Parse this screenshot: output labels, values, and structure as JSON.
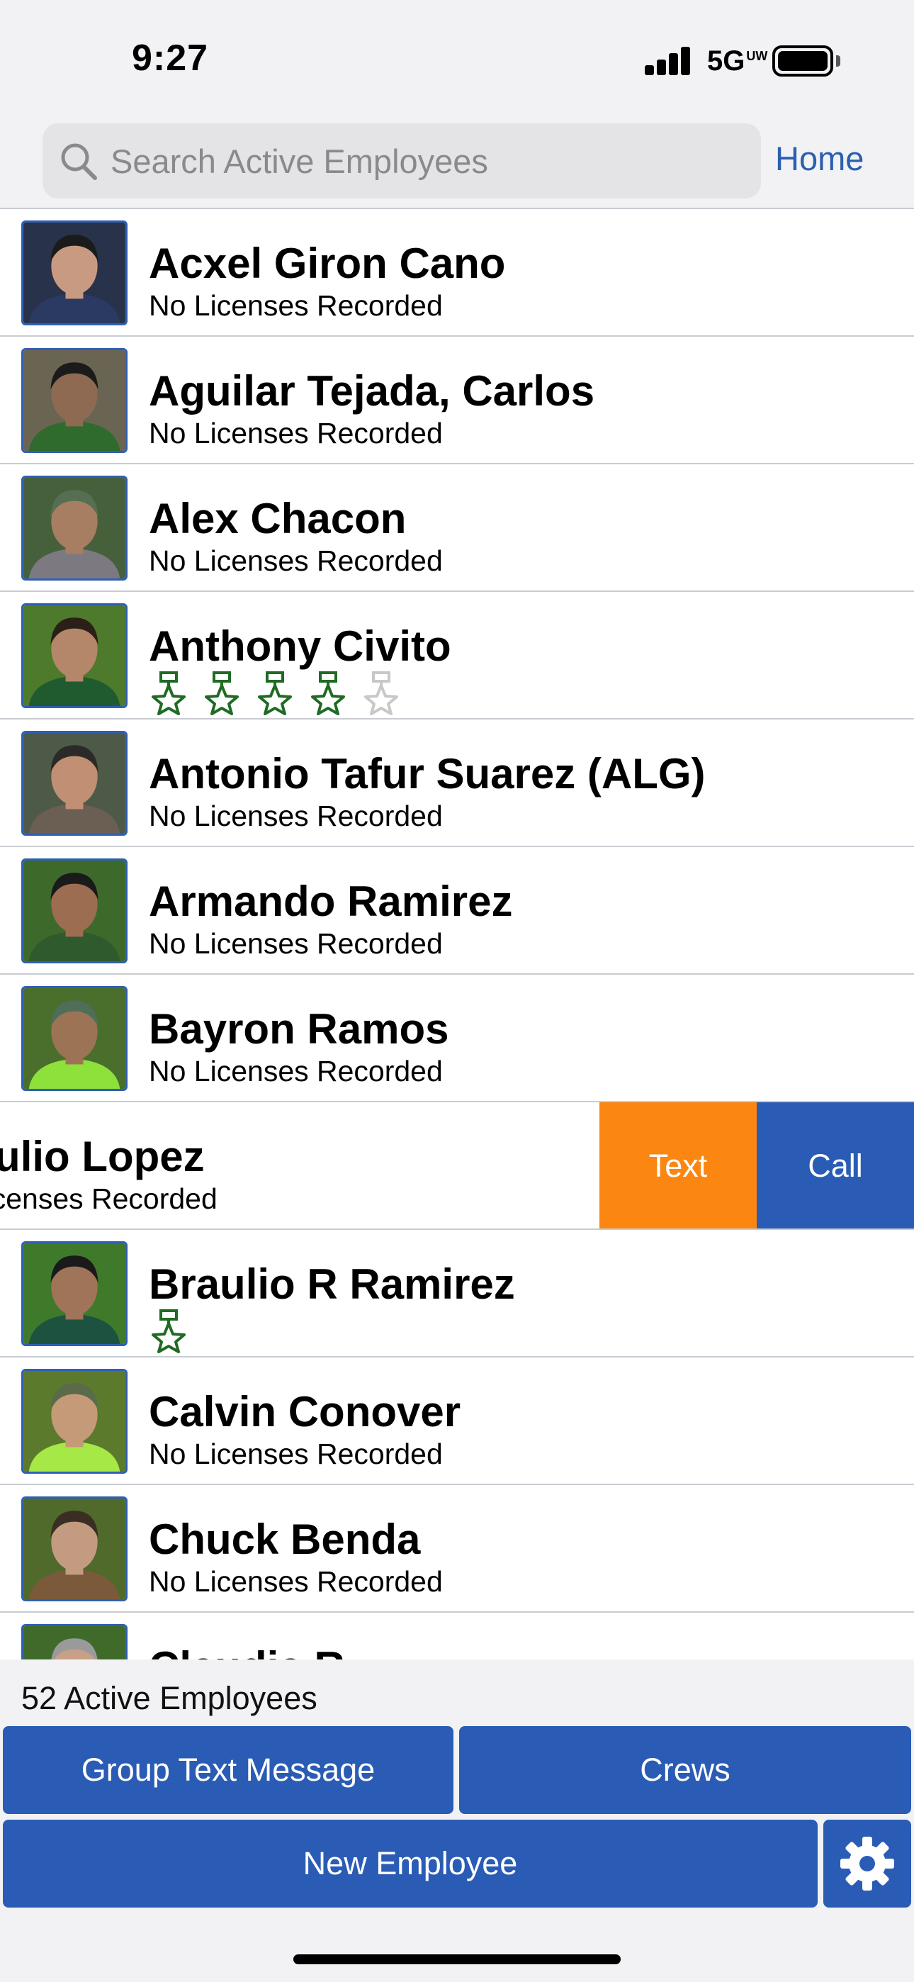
{
  "status_bar": {
    "time": "9:27",
    "network": "5G",
    "network_super": "UW",
    "battery_level": 1.0
  },
  "search": {
    "placeholder": "Search Active Employees",
    "home_label": "Home"
  },
  "employees": [
    {
      "name": "Acxel Giron Cano",
      "subtitle": "No Licenses Recorded",
      "photo": {
        "bg": "#28324a",
        "skin": "#c99a82",
        "shirt": "#2b3a63",
        "hair": "#1b1b1b"
      }
    },
    {
      "name": "Aguilar Tejada, Carlos",
      "subtitle": "No Licenses Recorded",
      "photo": {
        "bg": "#6a6552",
        "skin": "#8e6a52",
        "shirt": "#2e6b2d",
        "hair": "#1b1b1b"
      }
    },
    {
      "name": "Alex Chacon",
      "subtitle": "No Licenses Recorded",
      "photo": {
        "bg": "#46603c",
        "skin": "#a87e63",
        "shirt": "#7c7a80",
        "hair": "#566f52"
      }
    },
    {
      "name": "Anthony Civito",
      "licenses_earned": 4,
      "licenses_total": 5,
      "photo": {
        "bg": "#4d7a2b",
        "skin": "#b5876a",
        "shirt": "#1f5b2f",
        "hair": "#2a2018"
      }
    },
    {
      "name": "Antonio Tafur Suarez (ALG)",
      "subtitle": "No Licenses Recorded",
      "photo": {
        "bg": "#4e5a48",
        "skin": "#c08f74",
        "shirt": "#6b5e52",
        "hair": "#2c2a28"
      }
    },
    {
      "name": "Armando Ramirez",
      "subtitle": "No Licenses Recorded",
      "photo": {
        "bg": "#3d6a2a",
        "skin": "#9c6d50",
        "shirt": "#2f5a2e",
        "hair": "#1a1a1a"
      }
    },
    {
      "name": "Bayron Ramos",
      "subtitle": "No Licenses Recorded",
      "photo": {
        "bg": "#4a6e2c",
        "skin": "#9d7355",
        "shirt": "#8ee03a",
        "hair": "#4e6e58"
      }
    },
    {
      "name": "Braulio Lopez",
      "subtitle": "No Licenses Recorded",
      "swiped": true,
      "text_label": "Text",
      "call_label": "Call",
      "photo": {
        "bg": "#3d6a2a",
        "skin": "#9a6e52",
        "shirt": "#2f5a2e",
        "hair": "#1a1a1a"
      }
    },
    {
      "name": "Braulio R Ramirez",
      "licenses_earned": 1,
      "licenses_total": 1,
      "photo": {
        "bg": "#3f7a2a",
        "skin": "#a07458",
        "shirt": "#1e5240",
        "hair": "#1a1a1a"
      }
    },
    {
      "name": "Calvin Conover",
      "subtitle": "No Licenses Recorded",
      "photo": {
        "bg": "#5b7a2c",
        "skin": "#c49a78",
        "shirt": "#a6e845",
        "hair": "#5a6a4a"
      }
    },
    {
      "name": "Chuck Benda",
      "subtitle": "No Licenses Recorded",
      "photo": {
        "bg": "#4f6a2a",
        "skin": "#c39b80",
        "shirt": "#7a5a3a",
        "hair": "#3a2e24"
      }
    },
    {
      "name": "Claudia R",
      "subtitle": "",
      "photo": {
        "bg": "#3f6a2a",
        "skin": "#c8a088",
        "shirt": "#444",
        "hair": "#9a9a9a"
      }
    }
  ],
  "footer": {
    "count_label": "52 Active Employees",
    "group_text_label": "Group Text Message",
    "crews_label": "Crews",
    "new_employee_label": "New Employee"
  },
  "colors": {
    "accent": "#2a5cb5",
    "text_action": "#fb8611",
    "license_star": "#1f6b23",
    "license_star_empty": "#c8c8c8"
  }
}
